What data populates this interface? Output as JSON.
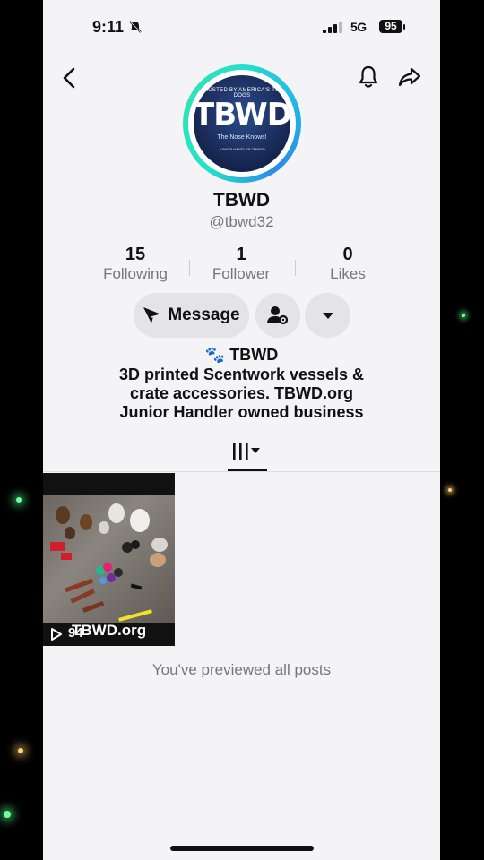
{
  "status_bar": {
    "time": "9:11",
    "network": "5G",
    "battery": "95"
  },
  "profile": {
    "display_name": "TBWD",
    "handle": "@tbwd32",
    "avatar": {
      "top_text": "TRUSTED BY AMERICA'S TOP DOGS",
      "logo_text": "TBWD",
      "tagline": "The Nose Knows!",
      "subtext": "JUNIOR HANDLER OWNED"
    }
  },
  "stats": [
    {
      "value": "15",
      "label": "Following"
    },
    {
      "value": "1",
      "label": "Follower"
    },
    {
      "value": "0",
      "label": "Likes"
    }
  ],
  "actions": {
    "message_label": "Message"
  },
  "bio": {
    "name_line": "🐾 TBWD",
    "lines": [
      "3D printed Scentwork vessels &",
      "crate accessories. TBWD.org",
      "Junior Handler owned business"
    ]
  },
  "posts": [
    {
      "views": "94",
      "caption": "TBWD.org"
    }
  ],
  "end_message": "You've previewed all posts",
  "colors": {
    "accent_ring": "#26e0c8",
    "background": "#f4f4f6"
  }
}
